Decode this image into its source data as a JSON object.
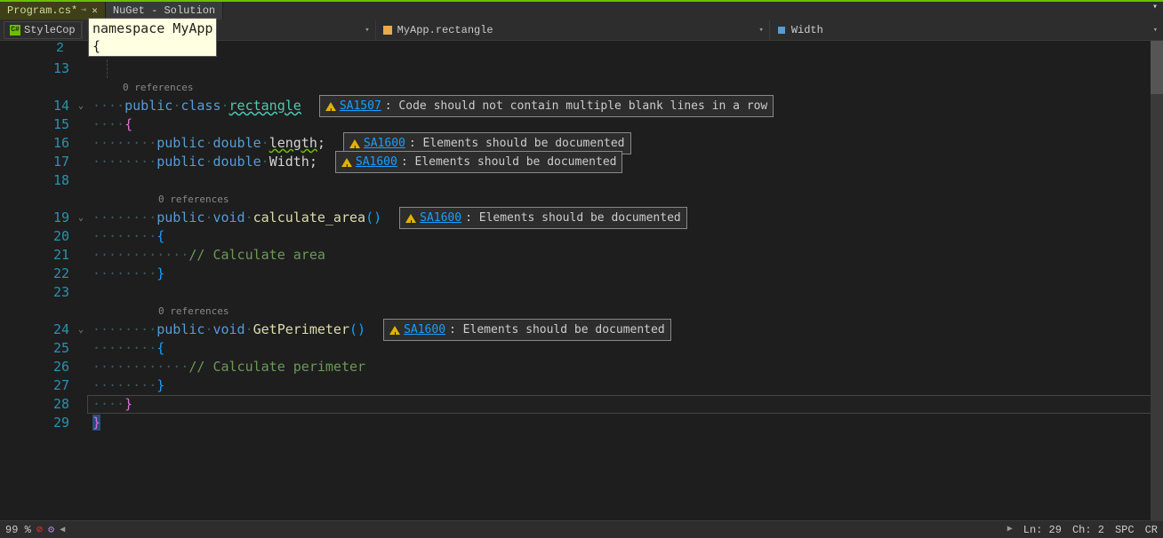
{
  "tabs": [
    {
      "label": "Program.cs*",
      "active": true
    },
    {
      "label": "NuGet - Solution",
      "active": false
    }
  ],
  "toolbar": {
    "stylecop_label": "StyleCop"
  },
  "nav": {
    "scope1": "",
    "scope2": "MyApp.rectangle",
    "scope3": "Width"
  },
  "hint_overlay_line1": "namespace MyApp",
  "hint_overlay_line2": "{",
  "gutter_fixed_top": "2",
  "codelens_0ref": "0 references",
  "warnings": {
    "sa1507": {
      "code": "SA1507",
      "msg": ": Code should not contain multiple blank lines in a row"
    },
    "sa1600": {
      "code": "SA1600",
      "msg": ": Elements should be documented"
    }
  },
  "code": {
    "l13": "",
    "l14_pre": "····",
    "l14_kw1": "public",
    "l14_sp1": "·",
    "l14_kw2": "class",
    "l14_sp2": "·",
    "l14_type": "rectangle",
    "l15_pre": "····",
    "l15_br": "{",
    "l16_pre": "········",
    "l16_kw1": "public",
    "l16_sp1": "·",
    "l16_kw2": "double",
    "l16_sp2": "·",
    "l16_id": "length",
    "l16_sc": ";",
    "l17_pre": "········",
    "l17_kw1": "public",
    "l17_sp1": "·",
    "l17_kw2": "double",
    "l17_sp2": "·",
    "l17_id": "Width",
    "l17_sc": ";",
    "l18_pre": "",
    "l19_pre": "········",
    "l19_kw1": "public",
    "l19_sp1": "·",
    "l19_kw2": "void",
    "l19_sp2": "·",
    "l19_id": "calculate_area",
    "l19_par": "()",
    "l20_pre": "········",
    "l20_br": "{",
    "l21_pre": "············",
    "l21_cm": "// Calculate area",
    "l22_pre": "········",
    "l22_br": "}",
    "l23_pre": "",
    "l24_pre": "········",
    "l24_kw1": "public",
    "l24_sp1": "·",
    "l24_kw2": "void",
    "l24_sp2": "·",
    "l24_id": "GetPerimeter",
    "l24_par": "()",
    "l25_pre": "········",
    "l25_br": "{",
    "l26_pre": "············",
    "l26_cm": "// Calculate perimeter",
    "l27_pre": "········",
    "l27_br": "}",
    "l28_pre": "····",
    "l28_br": "}",
    "l29_br": "}"
  },
  "line_numbers": {
    "n13": "13",
    "n14": "14",
    "n15": "15",
    "n16": "16",
    "n17": "17",
    "n18": "18",
    "n19": "19",
    "n20": "20",
    "n21": "21",
    "n22": "22",
    "n23": "23",
    "n24": "24",
    "n25": "25",
    "n26": "26",
    "n27": "27",
    "n28": "28",
    "n29": "29"
  },
  "status": {
    "zoom": "99 %",
    "ln": "Ln: 29",
    "ch": "Ch: 2",
    "spc": "SPC",
    "crlf": "CR"
  }
}
